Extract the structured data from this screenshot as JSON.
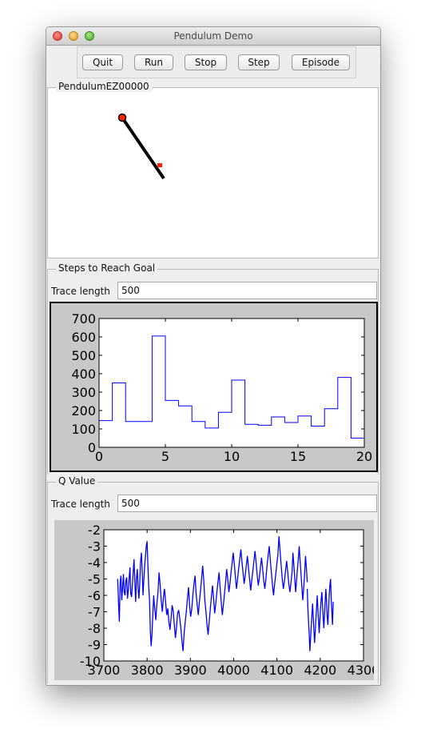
{
  "window": {
    "title": "Pendulum Demo"
  },
  "toolbar": {
    "buttons": [
      {
        "id": "quit",
        "label": "Quit"
      },
      {
        "id": "run",
        "label": "Run"
      },
      {
        "id": "stop",
        "label": "Stop"
      },
      {
        "id": "step",
        "label": "Step"
      },
      {
        "id": "episode",
        "label": "Episode"
      }
    ]
  },
  "pendulum_panel": {
    "title": "PendulumEZ00000",
    "pendulum_color": "#000000",
    "pivot_color": "#ff2200",
    "goal_color": "#ff2200"
  },
  "steps_panel": {
    "title": "Steps to Reach Goal",
    "trace_label": "Trace length",
    "trace_value": "500"
  },
  "q_panel": {
    "title": "Q Value",
    "trace_label": "Trace length",
    "trace_value": "500"
  },
  "colors": {
    "line": "#0000ff",
    "plot_bg": "#c8c8c8"
  },
  "chart_data": [
    {
      "type": "line",
      "style": "steps-post",
      "x": [
        0,
        1,
        2,
        3,
        4,
        5,
        6,
        7,
        8,
        9,
        10,
        11,
        12,
        13,
        14,
        15,
        16,
        17,
        18,
        19,
        20
      ],
      "values": [
        145,
        350,
        140,
        140,
        605,
        255,
        225,
        140,
        105,
        190,
        365,
        125,
        120,
        165,
        135,
        170,
        115,
        210,
        380,
        50,
        50
      ],
      "xlim": [
        0,
        20
      ],
      "ylim": [
        0,
        700
      ],
      "xticks": [
        0,
        5,
        10,
        15,
        20
      ],
      "yticks": [
        0,
        100,
        200,
        300,
        400,
        500,
        600,
        700
      ],
      "grid": false
    },
    {
      "type": "line",
      "xlim": [
        3700,
        4300
      ],
      "ylim": [
        -10,
        -2
      ],
      "xticks": [
        3700,
        3800,
        3900,
        4000,
        4100,
        4200,
        4300
      ],
      "yticks": [
        -2,
        -3,
        -4,
        -5,
        -6,
        -7,
        -8,
        -9,
        -10
      ],
      "grid": false,
      "segments": [
        {
          "x_start": 3732,
          "x_end": 3815,
          "values": [
            -5.0,
            -6.5,
            -7.6,
            -5.2,
            -4.8,
            -6.3,
            -5.5,
            -4.7,
            -5.8,
            -6.0,
            -5.1,
            -4.9,
            -6.2,
            -5.7,
            -5.0,
            -4.3,
            -5.9,
            -6.1,
            -5.4,
            -4.6,
            -3.8,
            -5.2,
            -6.4,
            -5.0,
            -4.4,
            -5.6,
            -6.2,
            -5.3,
            -4.0,
            -3.4,
            -4.5,
            -6.0,
            -5.1,
            -4.2,
            -3.6,
            -3.0,
            -2.7,
            -4.1,
            -5.5,
            -6.3,
            -8.2,
            -9.1,
            -8.4,
            -7.2,
            -6.1
          ]
        },
        {
          "x_start": 3815,
          "x_end": 4135,
          "values": [
            -6.0,
            -6.8,
            -7.5,
            -6.5,
            -5.8,
            -4.6,
            -5.4,
            -6.3,
            -7.0,
            -6.1,
            -5.6,
            -6.4,
            -7.2,
            -6.8,
            -7.6,
            -8.1,
            -7.4,
            -6.6,
            -7.0,
            -7.8,
            -8.6,
            -7.9,
            -7.1,
            -6.9,
            -7.4,
            -8.0,
            -8.8,
            -9.4,
            -8.3,
            -7.6,
            -7.0,
            -6.2,
            -5.5,
            -6.6,
            -7.3,
            -6.8,
            -6.0,
            -5.3,
            -4.8,
            -5.9,
            -6.6,
            -7.2,
            -6.4,
            -5.7,
            -5.0,
            -4.2,
            -5.1,
            -6.3,
            -7.0,
            -7.8,
            -8.4,
            -7.6,
            -6.8,
            -6.1,
            -5.4,
            -6.2,
            -7.1,
            -6.5,
            -5.8,
            -5.2,
            -4.6,
            -5.5,
            -6.4,
            -7.2,
            -6.6,
            -5.9,
            -5.2,
            -4.4,
            -5.0,
            -5.8,
            -5.3,
            -4.6,
            -4.0,
            -3.4,
            -4.1,
            -4.9,
            -5.6,
            -5.0,
            -4.4,
            -3.8,
            -3.2,
            -3.9,
            -4.6,
            -5.3,
            -4.8,
            -4.2,
            -3.6,
            -4.3,
            -5.0,
            -5.7,
            -5.1,
            -4.5,
            -3.9,
            -3.3,
            -4.0,
            -4.8,
            -5.4,
            -4.9,
            -4.3,
            -3.7,
            -4.4,
            -5.1,
            -5.6,
            -5.0,
            -4.2,
            -3.6,
            -3.0,
            -3.8,
            -4.6,
            -5.4,
            -6.0,
            -5.3,
            -4.7,
            -4.1,
            -3.5,
            -2.4,
            -3.3,
            -4.2,
            -5.0,
            -5.6,
            -5.1,
            -4.5,
            -3.9,
            -4.6,
            -5.3,
            -5.8,
            -5.2,
            -4.6
          ]
        },
        {
          "x_start": 4135,
          "x_end": 4170,
          "values": [
            -4.6,
            -3.4,
            -4.2,
            -5.0,
            -5.8,
            -5.1,
            -4.4,
            -3.8,
            -3.0,
            -3.9,
            -4.7,
            -5.5,
            -6.3,
            -5.6,
            -4.8,
            -3.6,
            -4.3,
            -5.2
          ]
        },
        {
          "x_start": 4170,
          "x_end": 4230,
          "values": [
            -5.6,
            -6.8,
            -7.6,
            -8.4,
            -9.4,
            -8.7,
            -7.9,
            -7.2,
            -6.5,
            -7.3,
            -8.1,
            -8.9,
            -8.2,
            -7.5,
            -6.7,
            -6.0,
            -6.8,
            -7.6,
            -8.3,
            -7.5,
            -6.8,
            -6.2,
            -5.8,
            -6.6,
            -7.4,
            -8.0,
            -7.1,
            -6.3,
            -5.6,
            -6.4,
            -7.3,
            -7.8,
            -6.9,
            -6.0,
            -5.4,
            -5.0,
            -6.2,
            -7.0,
            -7.8,
            -6.4
          ]
        }
      ]
    }
  ]
}
